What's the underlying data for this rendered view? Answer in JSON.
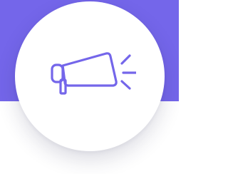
{
  "card": {
    "icon": "megaphone-icon",
    "accent_color": "#7466ea",
    "background_color": "#ffffff",
    "circle_color": "#ffffff",
    "icon_color": "#7466ea"
  }
}
